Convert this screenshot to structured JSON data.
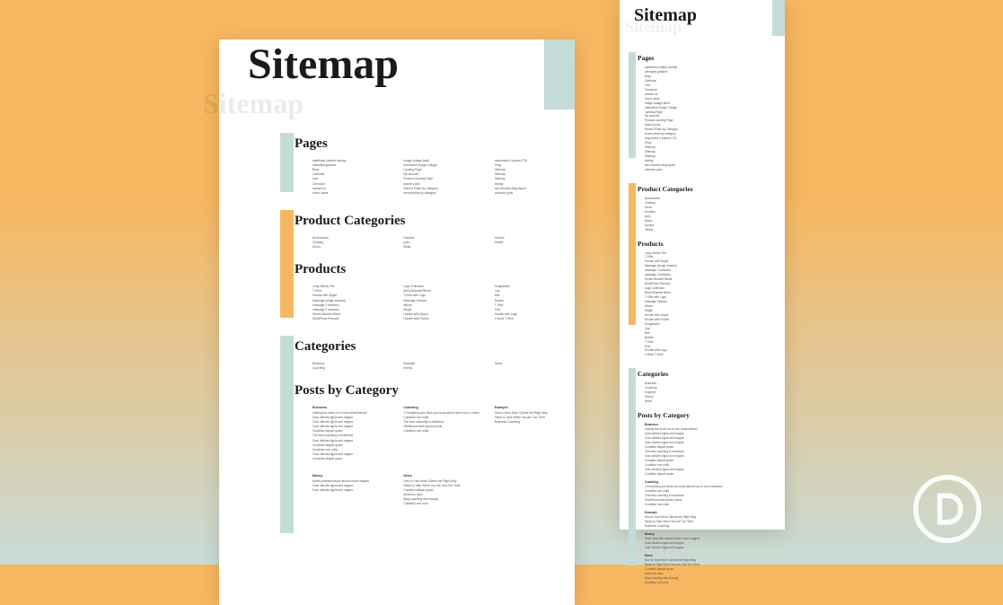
{
  "hero_title": "Sitemap",
  "sections": {
    "pages": {
      "heading": "Pages",
      "items": [
        "additional content overlay",
        "animated gradient",
        "Blog",
        "Calendar",
        "Cart",
        "Checkout",
        "contact us",
        "hover cards",
        "Image collage build",
        "Interactive Image Collage",
        "Landing Page",
        "My account",
        "Product Landing Page",
        "search pods",
        "Recent Posts by Category",
        "recent posts by category",
        "responsive 4 panels CTA",
        "Shop",
        "Sitemap",
        "Sitemap",
        "Sitemap",
        "testing",
        "two columns blog layout",
        "universe guns"
      ]
    },
    "product_categories": {
      "heading": "Product Categories",
      "items": [
        "Accessories",
        "Clothing",
        "Decor",
        "Hoodies",
        "yoho",
        "Music",
        "Archive",
        "Tshirts"
      ]
    },
    "products": {
      "heading": "Products",
      "items": [
        "Long Sleeve Tee",
        "T-Shirt",
        "Hoodie with Zipper",
        "Massage (single session)",
        "massage 2 sessions",
        "massage 3 sessions",
        "Denim Bomber Blend",
        "WordPress Pennant",
        "Logo Collection",
        "Berry Bracelet Blend",
        "T-Shirt with Logo",
        "Massage Session",
        "Album",
        "Single",
        "Hoodie with Zipper",
        "Hoodie with Pocket",
        "Sunglasses",
        "Cap",
        "Belt",
        "Beanie",
        "T-Shirt",
        "Polo",
        "Hoodie with Logo",
        "V-Neck T-Shirt"
      ]
    },
    "categories": {
      "heading": "Categories",
      "items": [
        "Business",
        "Coaching",
        "Example",
        "Money",
        "News"
      ]
    },
    "posts_by_category": {
      "heading": "Posts by Category",
      "groups": [
        {
          "title": "Business",
          "items": [
            "Getting the most out of your email listmail",
            "Cras ultricies ligula sed magna",
            "Cras ultricies ligula sed magna",
            "Cras ultricies ligula sed magna",
            "Curabitur aliquet quam",
            "The best coaching in existence",
            "Cras ultricies ligula sed magna",
            "Curabitur aliquet quam",
            "Curabitur non nulla",
            "Cras ultricies ligula sed magna",
            "Curabitur aliquet quam"
          ]
        },
        {
          "title": "Coaching",
          "items": [
            "1 Everything you think you know about how to run a business",
            "Curabitur non nulla",
            "The best coaching in existence",
            "Vestibulum ante ipsum primis",
            "Curabitur non nulla"
          ]
        },
        {
          "title": "Example",
          "items": [
            "How to Earn More Clients the Right Way",
            "Steps to Take When You are Too Tired",
            "Business Coaching"
          ]
        },
        {
          "title": "Money",
          "items": [
            "Morbi potential neque factors morbi magna",
            "Cras ultricies ligula sed magna",
            "Cras ultricies ligula sed magna"
          ]
        },
        {
          "title": "News",
          "items": [
            "How to Earn More Clients the Right Way",
            "Steps to Take When You are Just Too Tired",
            "Curabitur aliquet quam",
            "Morbi leo risus",
            "Blog coaching this enough",
            "Curabitur non eros"
          ]
        }
      ]
    }
  },
  "colors": {
    "teal": "#c4dcd8",
    "orange": "#f7b760"
  }
}
